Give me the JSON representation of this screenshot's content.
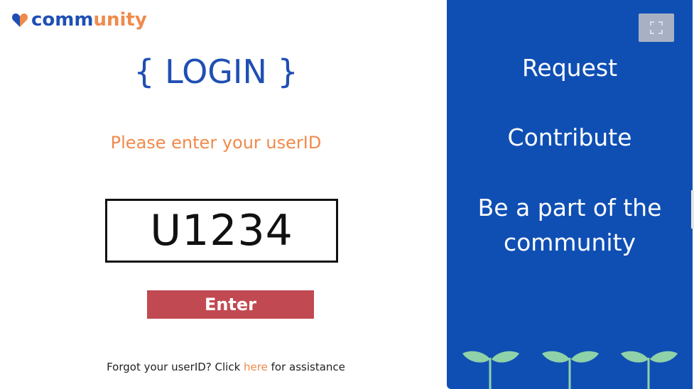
{
  "logo": {
    "text_part1": "comm",
    "text_part2": "unity",
    "heart_colors": [
      "#1f4fb4",
      "#f08a4b"
    ]
  },
  "login": {
    "title": "{ LOGIN }",
    "prompt": "Please enter your userID",
    "userid_value": "U1234",
    "enter_label": "Enter",
    "forgot_prefix": "Forgot your userID? Click ",
    "forgot_link": "here",
    "forgot_suffix": " for assistance"
  },
  "panel": {
    "line1": "Request",
    "line2": "Contribute",
    "line3a": "Be a part of the",
    "line3b": "community",
    "expand_icon": "fullscreen-icon",
    "decoration_icon": "sprout-icon"
  },
  "colors": {
    "brand_blue": "#1f4fb4",
    "panel_blue": "#0f4fb4",
    "accent_orange": "#f08a4b",
    "button_red": "#c14a52",
    "sprout_green": "#8fd1a8"
  }
}
